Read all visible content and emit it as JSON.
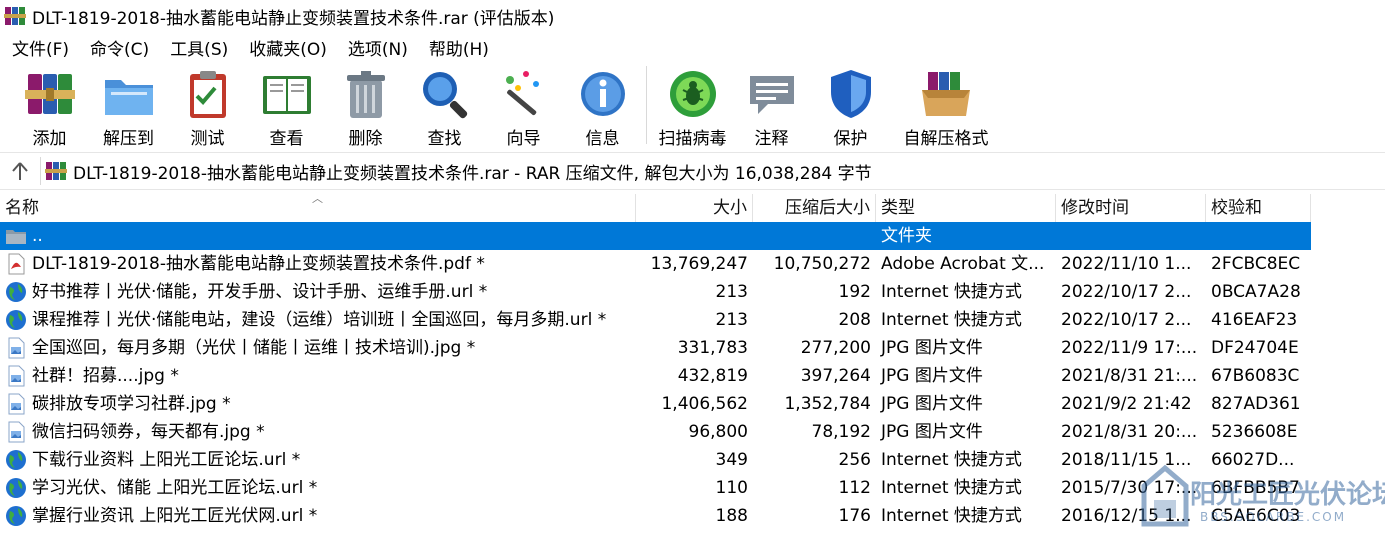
{
  "window": {
    "title": "DLT-1819-2018-抽水蓄能电站静止变频装置技术条件.rar (评估版本)"
  },
  "menu": [
    "文件(F)",
    "命令(C)",
    "工具(S)",
    "收藏夹(O)",
    "选项(N)",
    "帮助(H)"
  ],
  "toolbar": {
    "add": "添加",
    "extract": "解压到",
    "test": "测试",
    "view": "查看",
    "delete": "删除",
    "find": "查找",
    "wizard": "向导",
    "info": "信息",
    "scan": "扫描病毒",
    "comment": "注释",
    "protect": "保护",
    "sfx": "自解压格式"
  },
  "address": {
    "text": "DLT-1819-2018-抽水蓄能电站静止变频装置技术条件.rar - RAR 压缩文件, 解包大小为 16,038,284 字节"
  },
  "columns": {
    "name": "名称",
    "size": "大小",
    "packed": "压缩后大小",
    "type": "类型",
    "modified": "修改时间",
    "crc": "校验和"
  },
  "files": [
    {
      "name": "..",
      "size": "",
      "packed": "",
      "type": "文件夹",
      "modified": "",
      "crc": "",
      "icon": "folder-icon"
    },
    {
      "name": "DLT-1819-2018-抽水蓄能电站静止变频装置技术条件.pdf *",
      "size": "13,769,247",
      "packed": "10,750,272",
      "type": "Adobe Acrobat 文...",
      "modified": "2022/11/10 1...",
      "crc": "2FCBC8EC",
      "icon": "pdf-icon"
    },
    {
      "name": "好书推荐丨光伏·储能，开发手册、设计手册、运维手册.url *",
      "size": "213",
      "packed": "192",
      "type": "Internet 快捷方式",
      "modified": "2022/10/17 2...",
      "crc": "0BCA7A28",
      "icon": "globe-icon"
    },
    {
      "name": "课程推荐丨光伏·储能电站，建设（运维）培训班丨全国巡回，每月多期.url *",
      "size": "213",
      "packed": "208",
      "type": "Internet 快捷方式",
      "modified": "2022/10/17 2...",
      "crc": "416EAF23",
      "icon": "globe-icon"
    },
    {
      "name": "全国巡回，每月多期（光伏丨储能丨运维丨技术培训).jpg *",
      "size": "331,783",
      "packed": "277,200",
      "type": "JPG 图片文件",
      "modified": "2022/11/9 17:...",
      "crc": "DF24704E",
      "icon": "image-file-icon"
    },
    {
      "name": "社群！招募....jpg *",
      "size": "432,819",
      "packed": "397,264",
      "type": "JPG 图片文件",
      "modified": "2021/8/31 21:...",
      "crc": "67B6083C",
      "icon": "image-file-icon"
    },
    {
      "name": "碳排放专项学习社群.jpg *",
      "size": "1,406,562",
      "packed": "1,352,784",
      "type": "JPG 图片文件",
      "modified": "2021/9/2 21:42",
      "crc": "827AD361",
      "icon": "image-file-icon"
    },
    {
      "name": "微信扫码领券，每天都有.jpg *",
      "size": "96,800",
      "packed": "78,192",
      "type": "JPG 图片文件",
      "modified": "2021/8/31 20:...",
      "crc": "5236608E",
      "icon": "image-file-icon"
    },
    {
      "name": "下载行业资料 上阳光工匠论坛.url *",
      "size": "349",
      "packed": "256",
      "type": "Internet 快捷方式",
      "modified": "2018/11/15 1...",
      "crc": "66027D...",
      "icon": "globe-icon"
    },
    {
      "name": "学习光伏、储能 上阳光工匠论坛.url *",
      "size": "110",
      "packed": "112",
      "type": "Internet 快捷方式",
      "modified": "2015/7/30 17:...",
      "crc": "6BFBB5B7",
      "icon": "globe-icon"
    },
    {
      "name": "掌握行业资讯 上阳光工匠光伏网.url *",
      "size": "188",
      "packed": "176",
      "type": "Internet 快捷方式",
      "modified": "2016/12/15 1...",
      "crc": "C5AE6C03",
      "icon": "globe-icon"
    }
  ],
  "watermark": {
    "text": "阳光工匠光伏论坛",
    "sub": "BBS.SOLARBE.COM"
  }
}
